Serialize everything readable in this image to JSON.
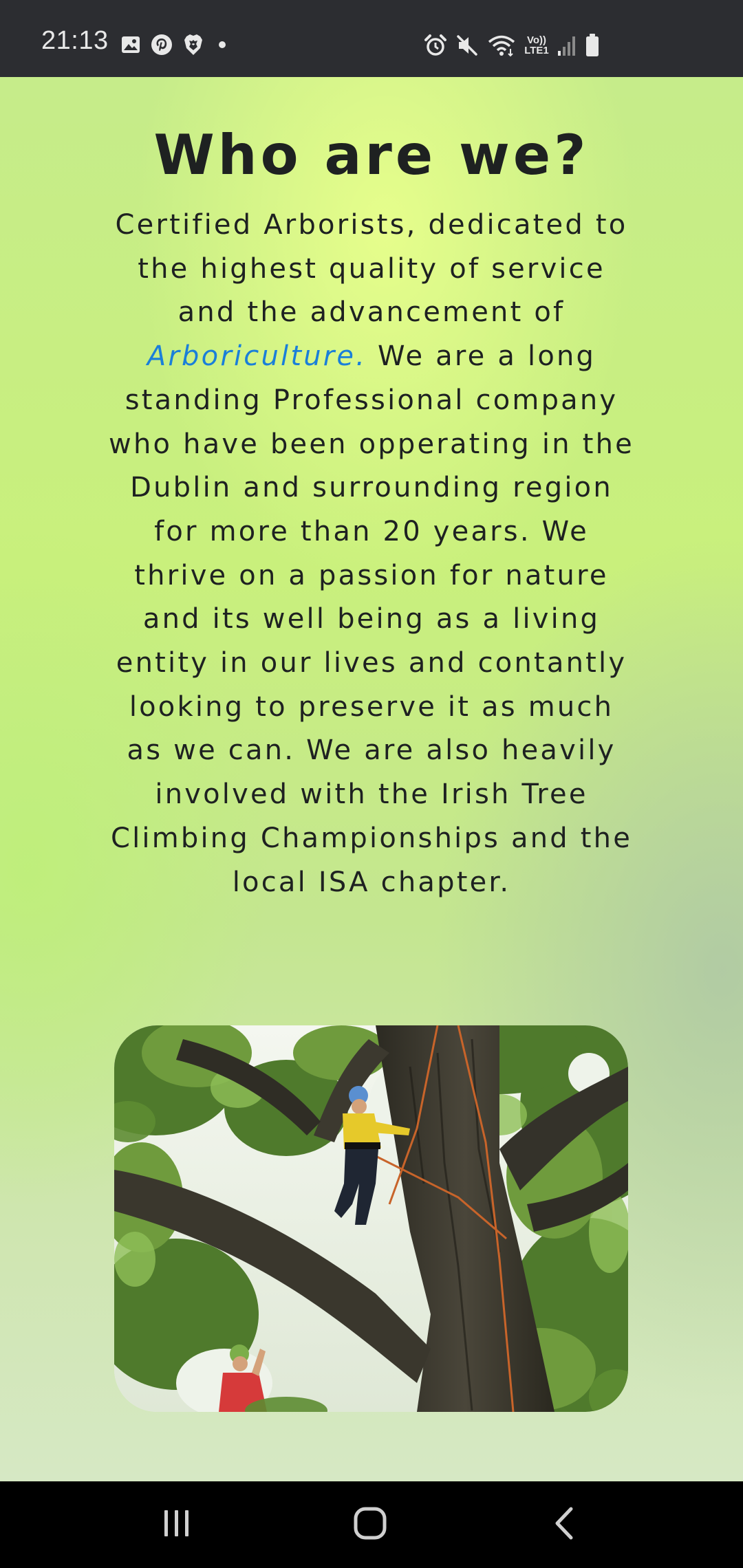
{
  "status_bar": {
    "time": "21:13",
    "network_label": "Vo)) LTE1",
    "notification_icons": [
      "gallery-icon",
      "pinterest-icon",
      "brave-icon",
      "more-dot-icon"
    ],
    "system_icons": [
      "alarm-icon",
      "mute-icon",
      "wifi-icon",
      "network-icon",
      "signal-icon",
      "battery-icon"
    ]
  },
  "page": {
    "title": "Who are we?",
    "intro_part1": "Certified Arborists, dedicated to the highest quality of service and the advancement of ",
    "intro_link": "Arboriculture.",
    "intro_part2": " We are a long standing Professional company who have been opperating in the Dublin and surrounding region for more than 20 years. We thrive on a passion for nature and its well being as a living entity in our lives and contantly looking to preserve it as much as we can. We are also heavily involved with the Irish Tree Climbing Championships and the local ISA chapter.",
    "link_color": "#1a7fd9",
    "text_color": "#1e2121"
  },
  "nav_bar": {
    "buttons": [
      "recent-apps",
      "home",
      "back"
    ]
  }
}
